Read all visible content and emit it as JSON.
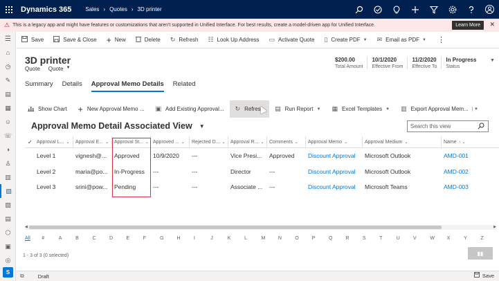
{
  "topbar": {
    "app_name": "Dynamics 365",
    "breadcrumbs": [
      "Sales",
      "Quotes",
      "3D printer"
    ],
    "icons": [
      "search-icon",
      "task-icon",
      "lightbulb-icon",
      "plus-icon",
      "filter-icon",
      "gear-icon",
      "help-icon",
      "user-icon"
    ],
    "avatar_initial": ""
  },
  "warning": {
    "text": "This is a legacy app and might have features or customizations that aren't supported in Unified Interface. For best results, create a model-driven app for Unified Interface.",
    "learn_more": "Learn More"
  },
  "command_bar": {
    "items": [
      {
        "label": "Save",
        "icon": "save-icon"
      },
      {
        "label": "Save & Close",
        "icon": "save-close-icon"
      },
      {
        "label": "New",
        "icon": "plus-icon"
      },
      {
        "label": "Delete",
        "icon": "trash-icon"
      },
      {
        "label": "Refresh",
        "icon": "refresh-icon"
      },
      {
        "label": "Look Up Address",
        "icon": "lookup-icon"
      },
      {
        "label": "Activate Quote",
        "icon": "activate-icon"
      },
      {
        "label": "Create PDF",
        "icon": "pdf-icon",
        "dropdown": true
      },
      {
        "label": "Email as PDF",
        "icon": "email-icon",
        "dropdown": true
      }
    ]
  },
  "header": {
    "title": "3D printer",
    "entity": "Quote",
    "form": "Quote",
    "fields": [
      {
        "value": "$200.00",
        "label": "Total Amount"
      },
      {
        "value": "10/1/2020",
        "label": "Effective From"
      },
      {
        "value": "11/2/2020",
        "label": "Effective To"
      },
      {
        "value": "In Progress",
        "label": "Status"
      }
    ]
  },
  "tabs": [
    "Summary",
    "Details",
    "Approval Memo Details",
    "Related"
  ],
  "subgrid_commands": [
    {
      "label": "Show Chart",
      "icon": "chart-icon"
    },
    {
      "label": "New Approval Memo ...",
      "icon": "plus-icon"
    },
    {
      "label": "Add Existing Approval...",
      "icon": "add-existing-icon"
    },
    {
      "label": "Refresh",
      "icon": "refresh-icon"
    },
    {
      "label": "Run Report",
      "icon": "report-icon",
      "dropdown": true
    },
    {
      "label": "Excel Templates",
      "icon": "excel-icon",
      "dropdown": true
    },
    {
      "label": "Export Approval Mem...",
      "icon": "export-icon",
      "dropdown": true
    }
  ],
  "view": {
    "title": "Approval Memo Detail Associated View",
    "search_placeholder": "Search this view"
  },
  "grid": {
    "columns": [
      "Approval L...",
      "Approval E...",
      "Approval St...",
      "Approved ...",
      "Rejected D...",
      "Approval R...",
      "Comments",
      "Approval Memo",
      "Approval Medium",
      "Name"
    ],
    "rows": [
      [
        "Level 1",
        "vignesh@...",
        "Approved",
        "10/9/2020",
        "---",
        "Vice Presi...",
        "Approved",
        "Discount Approval",
        "Microsoft Outlook",
        "AMD-001"
      ],
      [
        "Level 2",
        "maria@po...",
        "In-Progress",
        "---",
        "---",
        "Director",
        "---",
        "Discount Approval",
        "Microsoft Outlook",
        "AMD-002"
      ],
      [
        "Level 3",
        "srini@pow...",
        "Pending",
        "---",
        "---",
        "Associate ...",
        "---",
        "Discount Approval",
        "Microsoft Teams",
        "AMD-003"
      ]
    ]
  },
  "alphabet": [
    "All",
    "#",
    "A",
    "B",
    "C",
    "D",
    "E",
    "F",
    "G",
    "H",
    "I",
    "J",
    "K",
    "L",
    "M",
    "N",
    "O",
    "P",
    "Q",
    "R",
    "S",
    "T",
    "U",
    "V",
    "W",
    "X",
    "Y",
    "Z"
  ],
  "record_count": "1 - 3 of 3 (0 selected)",
  "footer": {
    "status": "Draft",
    "save": "Save"
  },
  "rail_badge": "S",
  "colors": {
    "nav_bg": "#002050",
    "accent": "#0078d4",
    "warning_bg": "#fde7e9",
    "highlight": "#d13438"
  }
}
